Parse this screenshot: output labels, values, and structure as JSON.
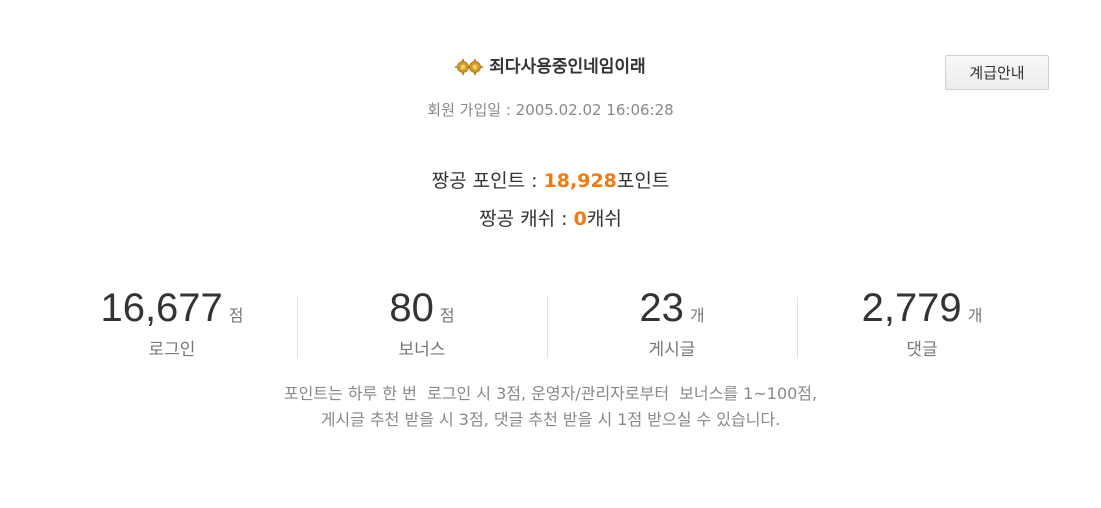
{
  "profile": {
    "nickname": "죄다사용중인네임이래",
    "rank_icon": "rank-icon",
    "join_label": "회원 가입일 : ",
    "join_date": "2005.02.02 16:06:28",
    "grade_button_label": "계급안내"
  },
  "points": {
    "point_label": "짱공 포인트 : ",
    "point_value": "18,928",
    "point_unit": "포인트",
    "cash_label": "짱공 캐쉬 : ",
    "cash_value": "0",
    "cash_unit": "캐쉬"
  },
  "stats": [
    {
      "value": "16,677",
      "unit": "점",
      "label": "로그인"
    },
    {
      "value": "80",
      "unit": "점",
      "label": "보너스"
    },
    {
      "value": "23",
      "unit": "개",
      "label": "게시글"
    },
    {
      "value": "2,779",
      "unit": "개",
      "label": "댓글"
    }
  ],
  "notice": {
    "line1": "포인트는 하루 한 번  로그인 시 3점, 운영자/관리자로부터  보너스를 1~100점,",
    "line2": "게시글 추천 받을 시 3점, 댓글 추천 받을 시 1점 받으실 수 있습니다."
  },
  "colors": {
    "accent": "#f07b15",
    "text": "#333333",
    "muted": "#888888"
  }
}
